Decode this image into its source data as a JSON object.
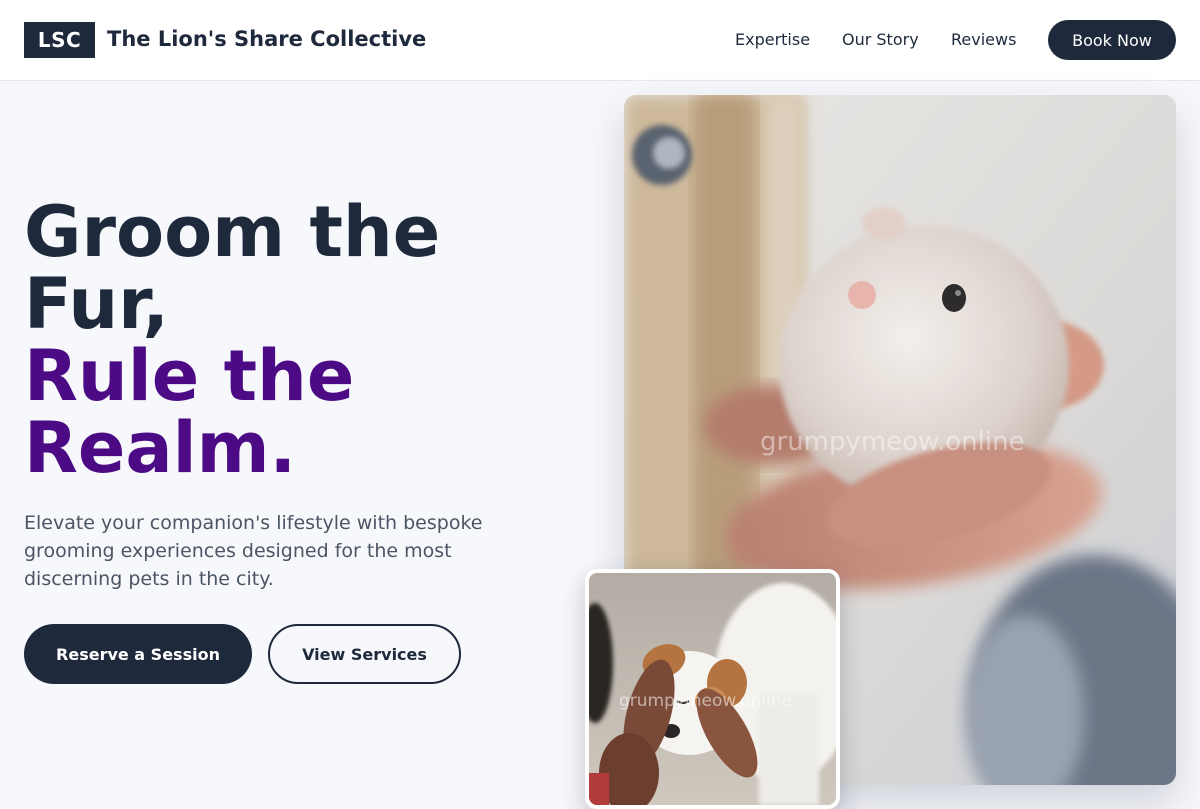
{
  "header": {
    "logo": "LSC",
    "brand": "The Lion's Share Collective",
    "nav": [
      {
        "label": "Expertise"
      },
      {
        "label": "Our Story"
      },
      {
        "label": "Reviews"
      }
    ],
    "cta": "Book Now"
  },
  "hero": {
    "headline_line1": "Groom the",
    "headline_line2": "Fur,",
    "headline_accent_line1": "Rule the",
    "headline_accent_line2": "Realm.",
    "subtext": "Elevate your companion's lifestyle with bespoke grooming experiences designed for the most discerning pets in the city.",
    "primary_button": "Reserve a Session",
    "secondary_button": "View Services"
  },
  "images": {
    "main_watermark": "grumpymeow.online",
    "inset_watermark": "grumpymeow.online"
  },
  "colors": {
    "primary": "#1e293b",
    "accent": "#4c0a85",
    "background": "#f7f8fc"
  }
}
